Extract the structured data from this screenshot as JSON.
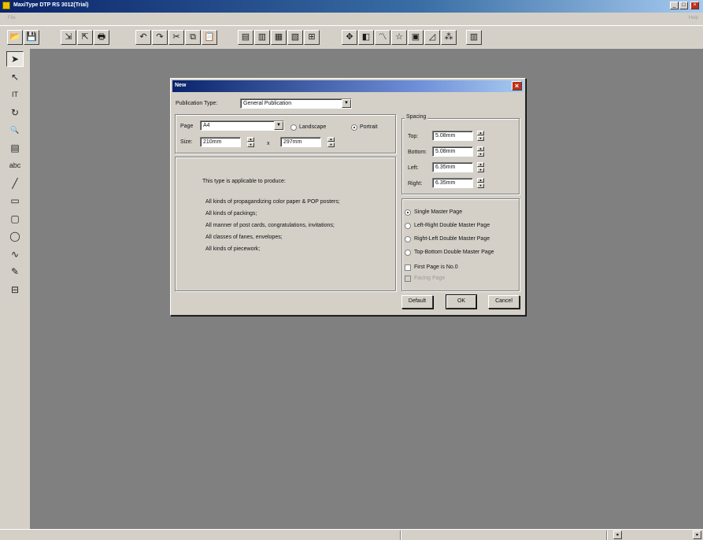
{
  "app": {
    "title": "MaxiType DTP RS 3012(Trial)",
    "menu": {
      "file": "File",
      "right": "Help"
    }
  },
  "toolbar": {
    "icons": [
      "open-folder-icon",
      "save-icon",
      "import-icon",
      "export-icon",
      "print-icon",
      "undo-icon",
      "redo-icon",
      "cut-icon",
      "copy-icon",
      "paste-icon",
      "frame-left-icon",
      "frame-center-icon",
      "frame-right-icon",
      "frame-link-icon",
      "table-icon",
      "move-cross-icon",
      "color-palette-icon",
      "curve-color-icon",
      "star-icon",
      "image-frame-icon",
      "chart-icon",
      "text-effect-icon",
      "page-layout-icon"
    ],
    "glyphs": [
      "📂",
      "💾",
      "⇲",
      "⇱",
      "🖶",
      "↶",
      "↷",
      "✂",
      "⧉",
      "📋",
      "▤",
      "▥",
      "▦",
      "▧",
      "⊞",
      "✥",
      "◧",
      "〽",
      "☆",
      "▣",
      "◿",
      "⁂",
      "▥"
    ]
  },
  "palette": {
    "tools": [
      {
        "name": "select-arrow-icon",
        "glyph": "➤",
        "active": true
      },
      {
        "name": "node-select-icon",
        "glyph": "↖",
        "active": false
      },
      {
        "name": "text-tool-icon",
        "glyph": "IT",
        "active": false
      },
      {
        "name": "rotate-icon",
        "glyph": "↻",
        "active": false
      },
      {
        "name": "zoom-icon",
        "glyph": "🔍",
        "active": false
      },
      {
        "name": "frame-tool-icon",
        "glyph": "▤",
        "active": false
      },
      {
        "name": "abc-text-icon",
        "glyph": "abc",
        "active": false
      },
      {
        "name": "line-tool-icon",
        "glyph": "╱",
        "active": false
      },
      {
        "name": "rectangle-tool-icon",
        "glyph": "▭",
        "active": false
      },
      {
        "name": "rounded-rect-tool-icon",
        "glyph": "▢",
        "active": false
      },
      {
        "name": "ellipse-tool-icon",
        "glyph": "◯",
        "active": false
      },
      {
        "name": "curve-tool-icon",
        "glyph": "∿",
        "active": false
      },
      {
        "name": "pen-tool-icon",
        "glyph": "✎",
        "active": false
      },
      {
        "name": "table-tool-icon",
        "glyph": "⊟",
        "active": false
      }
    ]
  },
  "dialog": {
    "title": "New",
    "publication_type_label": "Publication Type:",
    "publication_type_value": "General Publication",
    "page_label": "Page",
    "page_value": "A4",
    "landscape_label": "Landscape",
    "portrait_label": "Portrait",
    "orientation": "Portrait",
    "size_label": "Size:",
    "width_value": "210mm",
    "x_label": "x",
    "height_value": "297mm",
    "description_intro": "This type is applicable to produce:",
    "description_lines": [
      "All kinds of propagandizing color paper & POP posters;",
      "All kinds of packings;",
      "All manner of post cards, congratulations, invitations;",
      "All classes of fanes, envelopes;",
      "All kinds of piecework;"
    ],
    "spacing": {
      "title": "Spacing",
      "top_label": "Top:",
      "top_value": "5.08mm",
      "bottom_label": "Bottom:",
      "bottom_value": "5.08mm",
      "left_label": "Left:",
      "left_value": "6.35mm",
      "right_label": "Right:",
      "right_value": "6.35mm"
    },
    "master": {
      "options": [
        "Single Master Page",
        "Left-Right Double Master Page",
        "Right-Left Double Master Page",
        "Top-Bottom Double Master Page"
      ],
      "selected": "Single Master Page",
      "first_page_label": "First Page is No.0",
      "facing_page_label": "Facing Page"
    },
    "buttons": {
      "default": "Default",
      "ok": "OK",
      "cancel": "Cancel"
    }
  }
}
